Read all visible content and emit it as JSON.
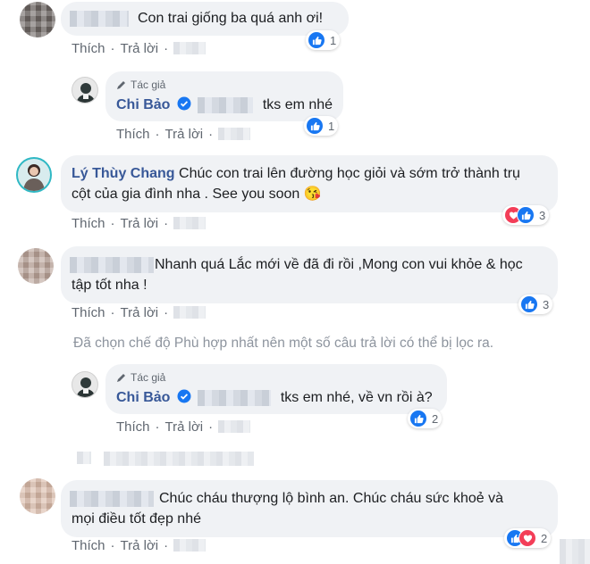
{
  "actions": {
    "like": "Thích",
    "reply": "Trả lời",
    "dot": "·"
  },
  "author_tag": "Tác giả",
  "comments": [
    {
      "text": "Con trai giống ba quá anh ơi!",
      "reactions": "1"
    },
    {
      "name": "Chi Bảo",
      "text": "tks em nhé",
      "reactions": "1"
    },
    {
      "name": "Lý Thùy Chang",
      "text_line1": "Chúc con trai lên đường học giỏi và sớm trở thành trụ",
      "text_line2": "cột của gia đình nha . See you soon 😘",
      "reactions": "3"
    },
    {
      "text_line1": "Nhanh quá Lắc mới về đã đi rồi ,Mong con vui khỏe & học",
      "text_line2": "tập tốt nha !",
      "reactions": "3"
    },
    {
      "name": "Chi Bảo",
      "text": "tks em nhé, về vn rồi à?",
      "reactions": "2"
    },
    {
      "text_line1": "Chúc cháu thượng lộ bình an. Chúc cháu sức khoẻ và",
      "text_line2": "mọi điều tốt đẹp nhé",
      "reactions": "2"
    }
  ],
  "filter_note": "Đã chọn chế độ Phù hợp nhất nên một số câu trả lời có thể bị lọc ra.",
  "colors": {
    "like": "#1877f2",
    "love": "#f33e58",
    "name": "#385898",
    "bubble": "#f0f2f5"
  }
}
